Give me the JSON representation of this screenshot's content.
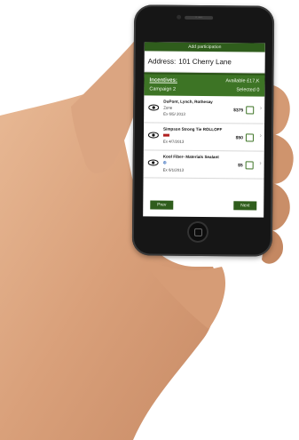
{
  "app": {
    "header_bar": "Add participation",
    "speaker_label": "ꞏ ꞏꞏꞏ"
  },
  "address": {
    "label": "Address:",
    "value": "101 Cherry Lane"
  },
  "incentives": {
    "label": "Incentives:",
    "available": "Available £17,K",
    "campaign": "Campaign 2",
    "selected": "Selected 0"
  },
  "items": [
    {
      "name": "DuPont, Lynch, Rothesay",
      "detail": "Zone",
      "date": "Ex 6/5/ 2013",
      "amount": "$375",
      "badge": "none"
    },
    {
      "name": "Simpson Strong Tie ROLLOFF",
      "detail": "",
      "date": "Ex 4/7/2013",
      "amount": "$50",
      "badge": "red"
    },
    {
      "name": "Kool Fiber- Materials Sealant",
      "detail": "",
      "date": "Ex 6/1/2013",
      "amount": "$5",
      "badge": "blue"
    }
  ],
  "buttons": {
    "prev": "Prev",
    "next": "Next"
  },
  "colors": {
    "brand_green": "#2f5d1c",
    "accent_green": "#3d7425"
  }
}
